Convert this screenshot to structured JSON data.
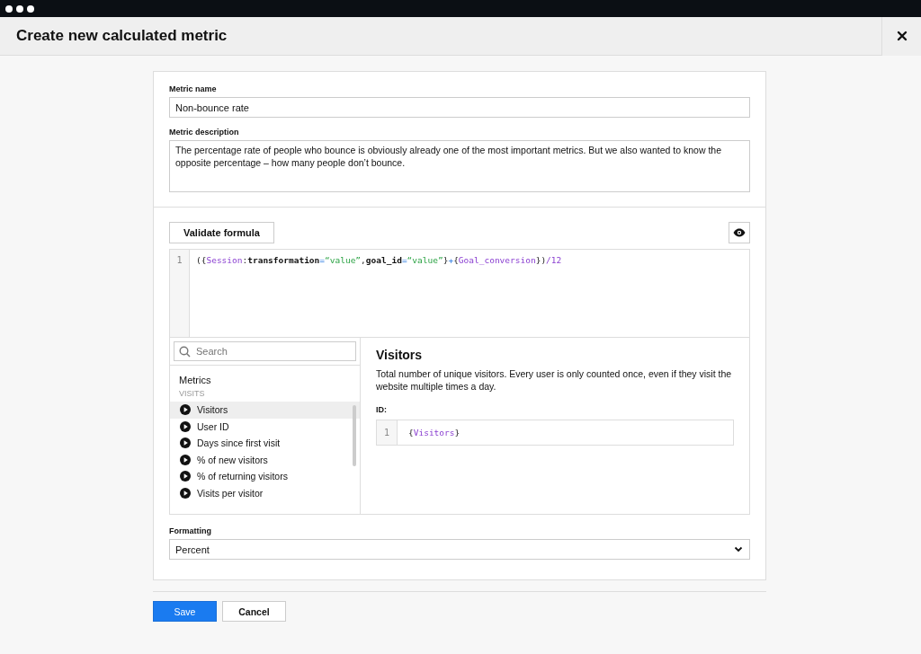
{
  "window": {
    "title": "Create new calculated metric"
  },
  "metric_name": {
    "label": "Metric name",
    "value": "Non-bounce rate"
  },
  "metric_description": {
    "label": "Metric description",
    "value": "The percentage rate of people who bounce is obviously already one of the most important metrics. But we also wanted to know the opposite percentage – how many people don’t bounce."
  },
  "formula": {
    "validate_button": "Validate formula",
    "lines": [
      {
        "number": "1",
        "tokens": [
          {
            "kind": "punct",
            "text": "({"
          },
          {
            "kind": "var",
            "text": "Session"
          },
          {
            "kind": "punct",
            "text": ":"
          },
          {
            "kind": "key",
            "text": "transformation"
          },
          {
            "kind": "op",
            "text": "="
          },
          {
            "kind": "string",
            "text": "“value”"
          },
          {
            "kind": "punct",
            "text": ","
          },
          {
            "kind": "key",
            "text": "goal_id"
          },
          {
            "kind": "op",
            "text": "="
          },
          {
            "kind": "string",
            "text": "“value”"
          },
          {
            "kind": "punct",
            "text": "}"
          },
          {
            "kind": "op",
            "text": "+"
          },
          {
            "kind": "punct",
            "text": "{"
          },
          {
            "kind": "var",
            "text": "Goal_conversion"
          },
          {
            "kind": "punct",
            "text": "})"
          },
          {
            "kind": "number",
            "text": "/12"
          }
        ]
      }
    ]
  },
  "browser": {
    "search": {
      "placeholder": "Search"
    },
    "heading": "Metrics",
    "group": "VISITS",
    "items": [
      {
        "label": "Visitors",
        "selected": true
      },
      {
        "label": "User ID",
        "selected": false
      },
      {
        "label": "Days since first visit",
        "selected": false
      },
      {
        "label": "% of new visitors",
        "selected": false
      },
      {
        "label": "% of returning visitors",
        "selected": false
      },
      {
        "label": "Visits per visitor",
        "selected": false
      }
    ]
  },
  "detail": {
    "title": "Visitors",
    "description": "Total number of unique visitors. Every user is only counted once, even if they visit the website multiple times a day.",
    "id_label": "ID:",
    "lines": [
      {
        "number": "1",
        "tokens": [
          {
            "kind": "punct",
            "text": "{"
          },
          {
            "kind": "var",
            "text": "Visitors"
          },
          {
            "kind": "punct",
            "text": "}"
          }
        ]
      }
    ]
  },
  "formatting": {
    "label": "Formatting",
    "value": "Percent"
  },
  "buttons": [
    {
      "label": "Save",
      "kind": "primary"
    },
    {
      "label": "Cancel",
      "kind": "secondary"
    }
  ]
}
